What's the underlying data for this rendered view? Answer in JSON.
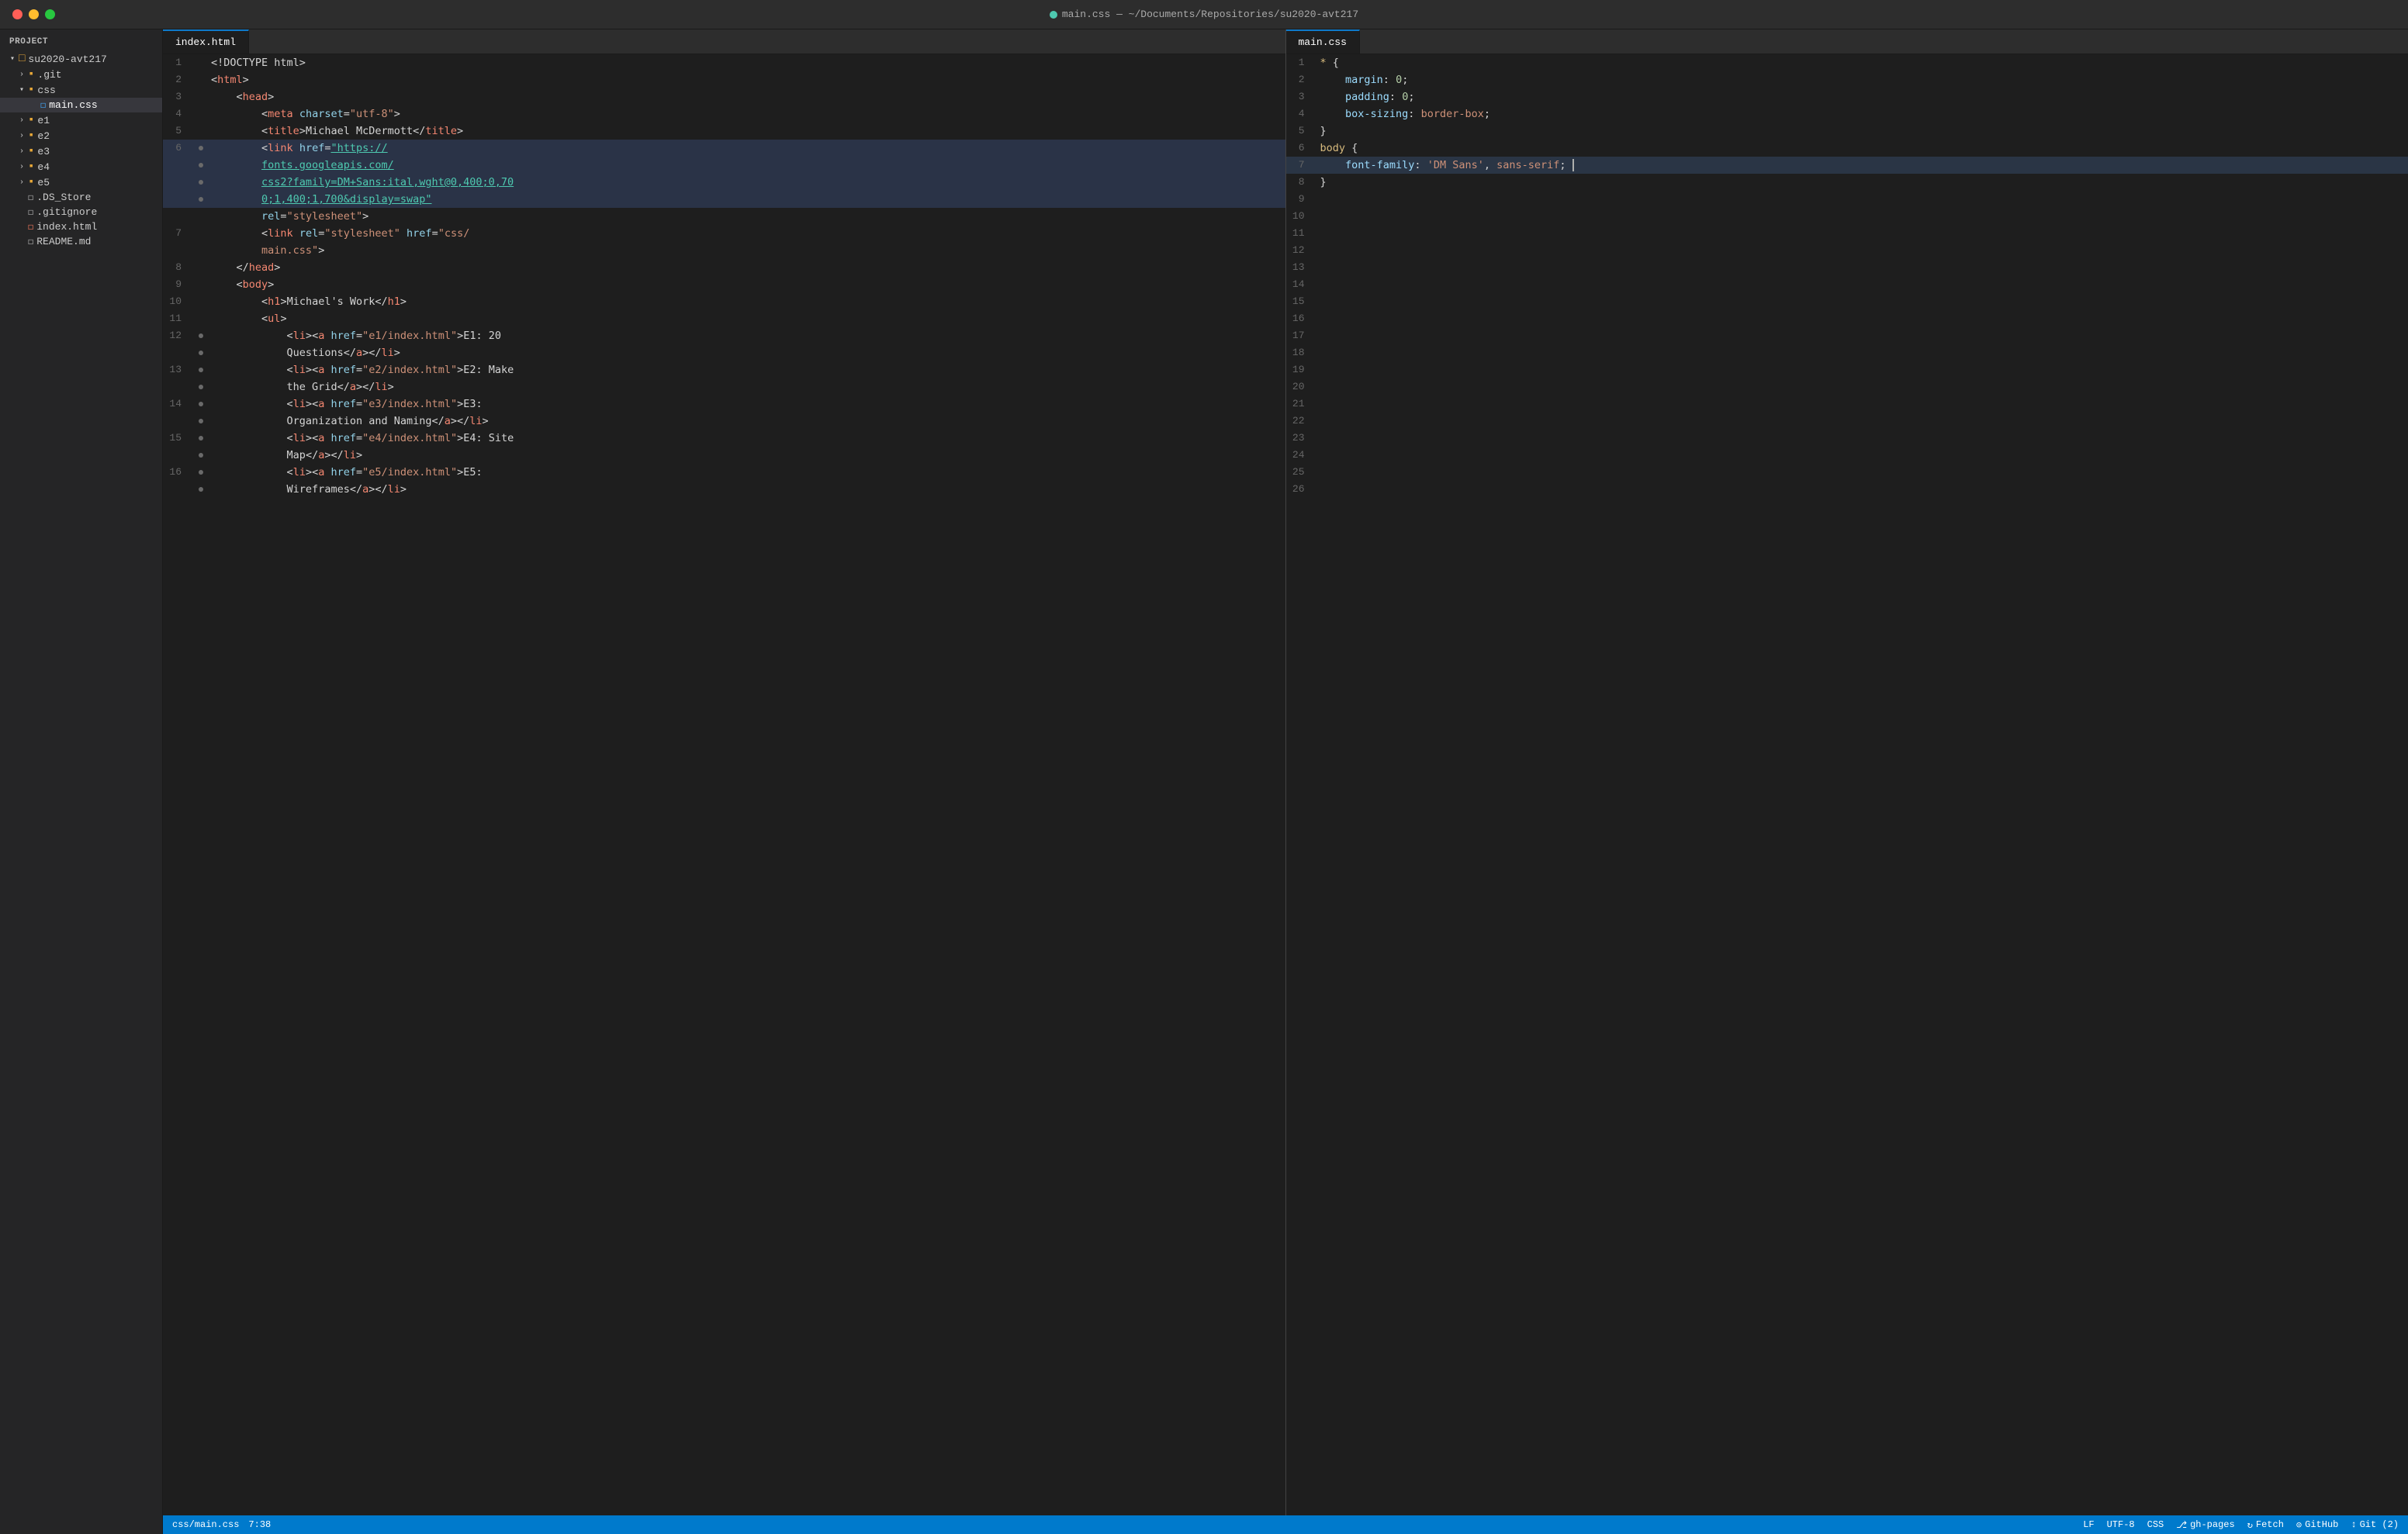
{
  "titlebar": {
    "title": "main.css — ~/Documents/Repositories/su2020-avt217"
  },
  "sidebar": {
    "header": "Project",
    "root": "su2020-avt217",
    "items": [
      {
        "id": "git",
        "label": ".git",
        "type": "folder",
        "indent": 1,
        "collapsed": true
      },
      {
        "id": "css",
        "label": "css",
        "type": "folder",
        "indent": 1,
        "open": true
      },
      {
        "id": "main-css",
        "label": "main.css",
        "type": "css-file",
        "indent": 2,
        "active": true
      },
      {
        "id": "e1",
        "label": "e1",
        "type": "folder",
        "indent": 1,
        "collapsed": true
      },
      {
        "id": "e2",
        "label": "e2",
        "type": "folder",
        "indent": 1,
        "collapsed": true
      },
      {
        "id": "e3",
        "label": "e3",
        "type": "folder",
        "indent": 1,
        "collapsed": true
      },
      {
        "id": "e4",
        "label": "e4",
        "type": "folder",
        "indent": 1,
        "collapsed": true
      },
      {
        "id": "e5",
        "label": "e5",
        "type": "folder",
        "indent": 1,
        "collapsed": true
      },
      {
        "id": "ds-store",
        "label": ".DS_Store",
        "type": "file",
        "indent": 1
      },
      {
        "id": "gitignore",
        "label": ".gitignore",
        "type": "file",
        "indent": 1
      },
      {
        "id": "index-html",
        "label": "index.html",
        "type": "html-file",
        "indent": 1
      },
      {
        "id": "readme",
        "label": "README.md",
        "type": "md-file",
        "indent": 1
      }
    ]
  },
  "left_pane": {
    "tab": "index.html",
    "lines": [
      {
        "num": 1,
        "tokens": [
          {
            "t": "<!DOCTYPE html>",
            "c": "c-white"
          }
        ]
      },
      {
        "num": 2,
        "tokens": [
          {
            "t": "<",
            "c": "c-punct"
          },
          {
            "t": "html",
            "c": "c-tag"
          },
          {
            "t": ">",
            "c": "c-punct"
          }
        ]
      },
      {
        "num": 3,
        "tokens": [
          {
            "t": "    <",
            "c": "c-punct"
          },
          {
            "t": "head",
            "c": "c-tag"
          },
          {
            "t": ">",
            "c": "c-punct"
          }
        ]
      },
      {
        "num": 4,
        "tokens": [
          {
            "t": "        <",
            "c": "c-punct"
          },
          {
            "t": "meta",
            "c": "c-tag"
          },
          {
            "t": " ",
            "c": "c-white"
          },
          {
            "t": "charset",
            "c": "c-attr"
          },
          {
            "t": "=",
            "c": "c-punct"
          },
          {
            "t": "\"utf-8\"",
            "c": "c-string"
          },
          {
            "t": ">",
            "c": "c-punct"
          }
        ]
      },
      {
        "num": 5,
        "tokens": [
          {
            "t": "        <",
            "c": "c-punct"
          },
          {
            "t": "title",
            "c": "c-tag"
          },
          {
            "t": ">Michael McDermott</",
            "c": "c-white"
          },
          {
            "t": "title",
            "c": "c-tag"
          },
          {
            "t": ">",
            "c": "c-punct"
          }
        ]
      },
      {
        "num": 6,
        "tokens": [
          {
            "t": "        <",
            "c": "c-punct"
          },
          {
            "t": "link",
            "c": "c-tag"
          },
          {
            "t": " ",
            "c": "c-white"
          },
          {
            "t": "href",
            "c": "c-attr"
          },
          {
            "t": "=",
            "c": "c-punct"
          },
          {
            "t": "\"https://",
            "c": "c-url"
          }
        ],
        "gutter": true
      },
      {
        "num": null,
        "tokens": [
          {
            "t": "        fonts.googleapis.com/",
            "c": "c-url"
          }
        ],
        "gutter": true,
        "continuation": true
      },
      {
        "num": null,
        "tokens": [
          {
            "t": "        css2?family=DM+Sans:ital,wght@0,400;0,70",
            "c": "c-url"
          }
        ],
        "gutter": true,
        "continuation": true
      },
      {
        "num": null,
        "tokens": [
          {
            "t": "        0;1,400;1,700&display=swap\"",
            "c": "c-url"
          }
        ],
        "gutter": true,
        "continuation": true
      },
      {
        "num": null,
        "tokens": [
          {
            "t": "        rel=\"stylesheet\">",
            "c": "c-white"
          }
        ],
        "gutter": true,
        "continuation": true
      },
      {
        "num": 7,
        "tokens": [
          {
            "t": "        <",
            "c": "c-punct"
          },
          {
            "t": "link",
            "c": "c-tag"
          },
          {
            "t": " ",
            "c": "c-white"
          },
          {
            "t": "rel",
            "c": "c-attr"
          },
          {
            "t": "=",
            "c": "c-punct"
          },
          {
            "t": "\"stylesheet\"",
            "c": "c-string"
          },
          {
            "t": " ",
            "c": "c-white"
          },
          {
            "t": "href",
            "c": "c-attr"
          },
          {
            "t": "=",
            "c": "c-punct"
          },
          {
            "t": "\"css/",
            "c": "c-string"
          }
        ]
      },
      {
        "num": null,
        "tokens": [
          {
            "t": "        main.css\">",
            "c": "c-string"
          }
        ],
        "continuation": true
      },
      {
        "num": 8,
        "tokens": [
          {
            "t": "    </",
            "c": "c-punct"
          },
          {
            "t": "head",
            "c": "c-tag"
          },
          {
            "t": ">",
            "c": "c-punct"
          }
        ]
      },
      {
        "num": 9,
        "tokens": [
          {
            "t": "    <",
            "c": "c-punct"
          },
          {
            "t": "body",
            "c": "c-tag"
          },
          {
            "t": ">",
            "c": "c-punct"
          }
        ]
      },
      {
        "num": 10,
        "tokens": [
          {
            "t": "        <",
            "c": "c-punct"
          },
          {
            "t": "h1",
            "c": "c-tag"
          },
          {
            "t": ">Michael's Work</",
            "c": "c-white"
          },
          {
            "t": "h1",
            "c": "c-tag"
          },
          {
            "t": ">",
            "c": "c-punct"
          }
        ]
      },
      {
        "num": 11,
        "tokens": [
          {
            "t": "        <",
            "c": "c-punct"
          },
          {
            "t": "ul",
            "c": "c-tag"
          },
          {
            "t": ">",
            "c": "c-punct"
          }
        ]
      },
      {
        "num": 12,
        "tokens": [
          {
            "t": "            <",
            "c": "c-punct"
          },
          {
            "t": "li",
            "c": "c-tag"
          },
          {
            "t": "><",
            "c": "c-punct"
          },
          {
            "t": "a",
            "c": "c-tag"
          },
          {
            "t": " ",
            "c": "c-white"
          },
          {
            "t": "href",
            "c": "c-attr"
          },
          {
            "t": "=",
            "c": "c-punct"
          },
          {
            "t": "\"e1/index.html\"",
            "c": "c-string"
          },
          {
            "t": ">E1: 20",
            "c": "c-white"
          }
        ],
        "gutter": true
      },
      {
        "num": null,
        "tokens": [
          {
            "t": "            Questions</",
            "c": "c-white"
          },
          {
            "t": "a",
            "c": "c-tag"
          },
          {
            "t": "></",
            "c": "c-punct"
          },
          {
            "t": "li",
            "c": "c-tag"
          },
          {
            "t": ">",
            "c": "c-punct"
          }
        ],
        "continuation": true,
        "gutter": true
      },
      {
        "num": 13,
        "tokens": [
          {
            "t": "            <",
            "c": "c-punct"
          },
          {
            "t": "li",
            "c": "c-tag"
          },
          {
            "t": "><",
            "c": "c-punct"
          },
          {
            "t": "a",
            "c": "c-tag"
          },
          {
            "t": " ",
            "c": "c-white"
          },
          {
            "t": "href",
            "c": "c-attr"
          },
          {
            "t": "=",
            "c": "c-punct"
          },
          {
            "t": "\"e2/index.html\"",
            "c": "c-string"
          },
          {
            "t": ">E2: Make",
            "c": "c-white"
          }
        ],
        "gutter": true
      },
      {
        "num": null,
        "tokens": [
          {
            "t": "            the Grid</",
            "c": "c-white"
          },
          {
            "t": "a",
            "c": "c-tag"
          },
          {
            "t": "></",
            "c": "c-punct"
          },
          {
            "t": "li",
            "c": "c-tag"
          },
          {
            "t": ">",
            "c": "c-punct"
          }
        ],
        "continuation": true,
        "gutter": true
      },
      {
        "num": 14,
        "tokens": [
          {
            "t": "            <",
            "c": "c-punct"
          },
          {
            "t": "li",
            "c": "c-tag"
          },
          {
            "t": "><",
            "c": "c-punct"
          },
          {
            "t": "a",
            "c": "c-tag"
          },
          {
            "t": " ",
            "c": "c-white"
          },
          {
            "t": "href",
            "c": "c-attr"
          },
          {
            "t": "=",
            "c": "c-punct"
          },
          {
            "t": "\"e3/index.html\"",
            "c": "c-string"
          },
          {
            "t": ">E3:",
            "c": "c-white"
          }
        ],
        "gutter": true
      },
      {
        "num": null,
        "tokens": [
          {
            "t": "            Organization and Naming</",
            "c": "c-white"
          },
          {
            "t": "a",
            "c": "c-tag"
          },
          {
            "t": "></",
            "c": "c-punct"
          },
          {
            "t": "li",
            "c": "c-tag"
          },
          {
            "t": ">",
            "c": "c-punct"
          }
        ],
        "continuation": true,
        "gutter": true
      },
      {
        "num": 15,
        "tokens": [
          {
            "t": "            <",
            "c": "c-punct"
          },
          {
            "t": "li",
            "c": "c-tag"
          },
          {
            "t": "><",
            "c": "c-punct"
          },
          {
            "t": "a",
            "c": "c-tag"
          },
          {
            "t": " ",
            "c": "c-white"
          },
          {
            "t": "href",
            "c": "c-attr"
          },
          {
            "t": "=",
            "c": "c-punct"
          },
          {
            "t": "\"e4/index.html\"",
            "c": "c-string"
          },
          {
            "t": ">E4: Site",
            "c": "c-white"
          }
        ],
        "gutter": true
      },
      {
        "num": null,
        "tokens": [
          {
            "t": "            Map</",
            "c": "c-white"
          },
          {
            "t": "a",
            "c": "c-tag"
          },
          {
            "t": "></",
            "c": "c-punct"
          },
          {
            "t": "li",
            "c": "c-tag"
          },
          {
            "t": ">",
            "c": "c-punct"
          }
        ],
        "continuation": true,
        "gutter": true
      },
      {
        "num": 16,
        "tokens": [
          {
            "t": "            <",
            "c": "c-punct"
          },
          {
            "t": "li",
            "c": "c-tag"
          },
          {
            "t": "><",
            "c": "c-punct"
          },
          {
            "t": "a",
            "c": "c-tag"
          },
          {
            "t": " ",
            "c": "c-white"
          },
          {
            "t": "href",
            "c": "c-attr"
          },
          {
            "t": "=",
            "c": "c-punct"
          },
          {
            "t": "\"e5/index.html\"",
            "c": "c-string"
          },
          {
            "t": ">E5:",
            "c": "c-white"
          }
        ],
        "gutter": true
      },
      {
        "num": null,
        "tokens": [
          {
            "t": "            Wireframes</",
            "c": "c-white"
          },
          {
            "t": "a",
            "c": "c-tag"
          },
          {
            "t": "></",
            "c": "c-punct"
          },
          {
            "t": "li",
            "c": "c-tag"
          },
          {
            "t": ">",
            "c": "c-punct"
          }
        ],
        "continuation": true,
        "gutter": true
      }
    ]
  },
  "right_pane": {
    "tab": "main.css",
    "lines": [
      {
        "num": 1,
        "tokens": [
          {
            "t": "* ",
            "c": "c-selector"
          },
          {
            "t": "{",
            "c": "c-punct"
          }
        ]
      },
      {
        "num": 2,
        "tokens": [
          {
            "t": "    ",
            "c": "c-white"
          },
          {
            "t": "margin",
            "c": "c-prop"
          },
          {
            "t": ": ",
            "c": "c-white"
          },
          {
            "t": "0",
            "c": "c-num"
          },
          {
            "t": ";",
            "c": "c-punct"
          }
        ]
      },
      {
        "num": 3,
        "tokens": [
          {
            "t": "    ",
            "c": "c-white"
          },
          {
            "t": "padding",
            "c": "c-prop"
          },
          {
            "t": ": ",
            "c": "c-white"
          },
          {
            "t": "0",
            "c": "c-num"
          },
          {
            "t": ";",
            "c": "c-punct"
          }
        ]
      },
      {
        "num": 4,
        "tokens": [
          {
            "t": "    ",
            "c": "c-white"
          },
          {
            "t": "box-sizing",
            "c": "c-prop"
          },
          {
            "t": ": ",
            "c": "c-white"
          },
          {
            "t": "border-box",
            "c": "c-value"
          },
          {
            "t": ";",
            "c": "c-punct"
          }
        ]
      },
      {
        "num": 5,
        "tokens": [
          {
            "t": "}",
            "c": "c-punct"
          }
        ]
      },
      {
        "num": 6,
        "tokens": [
          {
            "t": "body",
            "c": "c-selector"
          },
          {
            "t": " {",
            "c": "c-punct"
          }
        ]
      },
      {
        "num": 7,
        "tokens": [
          {
            "t": "    ",
            "c": "c-white"
          },
          {
            "t": "font-family",
            "c": "c-prop"
          },
          {
            "t": ": ",
            "c": "c-white"
          },
          {
            "t": "'DM Sans'",
            "c": "c-string"
          },
          {
            "t": ", ",
            "c": "c-white"
          },
          {
            "t": "sans-serif",
            "c": "c-value"
          },
          {
            "t": ";",
            "c": "c-punct"
          }
        ],
        "cursor": true
      },
      {
        "num": 8,
        "tokens": [
          {
            "t": "}",
            "c": "c-punct"
          }
        ]
      },
      {
        "num": 9,
        "tokens": []
      },
      {
        "num": 10,
        "tokens": []
      },
      {
        "num": 11,
        "tokens": []
      },
      {
        "num": 12,
        "tokens": []
      },
      {
        "num": 13,
        "tokens": []
      },
      {
        "num": 14,
        "tokens": []
      },
      {
        "num": 15,
        "tokens": []
      },
      {
        "num": 16,
        "tokens": []
      },
      {
        "num": 17,
        "tokens": []
      },
      {
        "num": 18,
        "tokens": []
      },
      {
        "num": 19,
        "tokens": []
      },
      {
        "num": 20,
        "tokens": []
      },
      {
        "num": 21,
        "tokens": []
      },
      {
        "num": 22,
        "tokens": []
      },
      {
        "num": 23,
        "tokens": []
      },
      {
        "num": 24,
        "tokens": []
      },
      {
        "num": 25,
        "tokens": []
      },
      {
        "num": 26,
        "tokens": []
      }
    ]
  },
  "status_bar": {
    "file_path": "css/main.css",
    "cursor_pos": "7:38",
    "line_ending": "LF",
    "encoding": "UTF-8",
    "language": "CSS",
    "branch_icon": "⎇",
    "branch": "gh-pages",
    "fetch": "Fetch",
    "github": "GitHub",
    "git_changes": "Git (2)"
  }
}
